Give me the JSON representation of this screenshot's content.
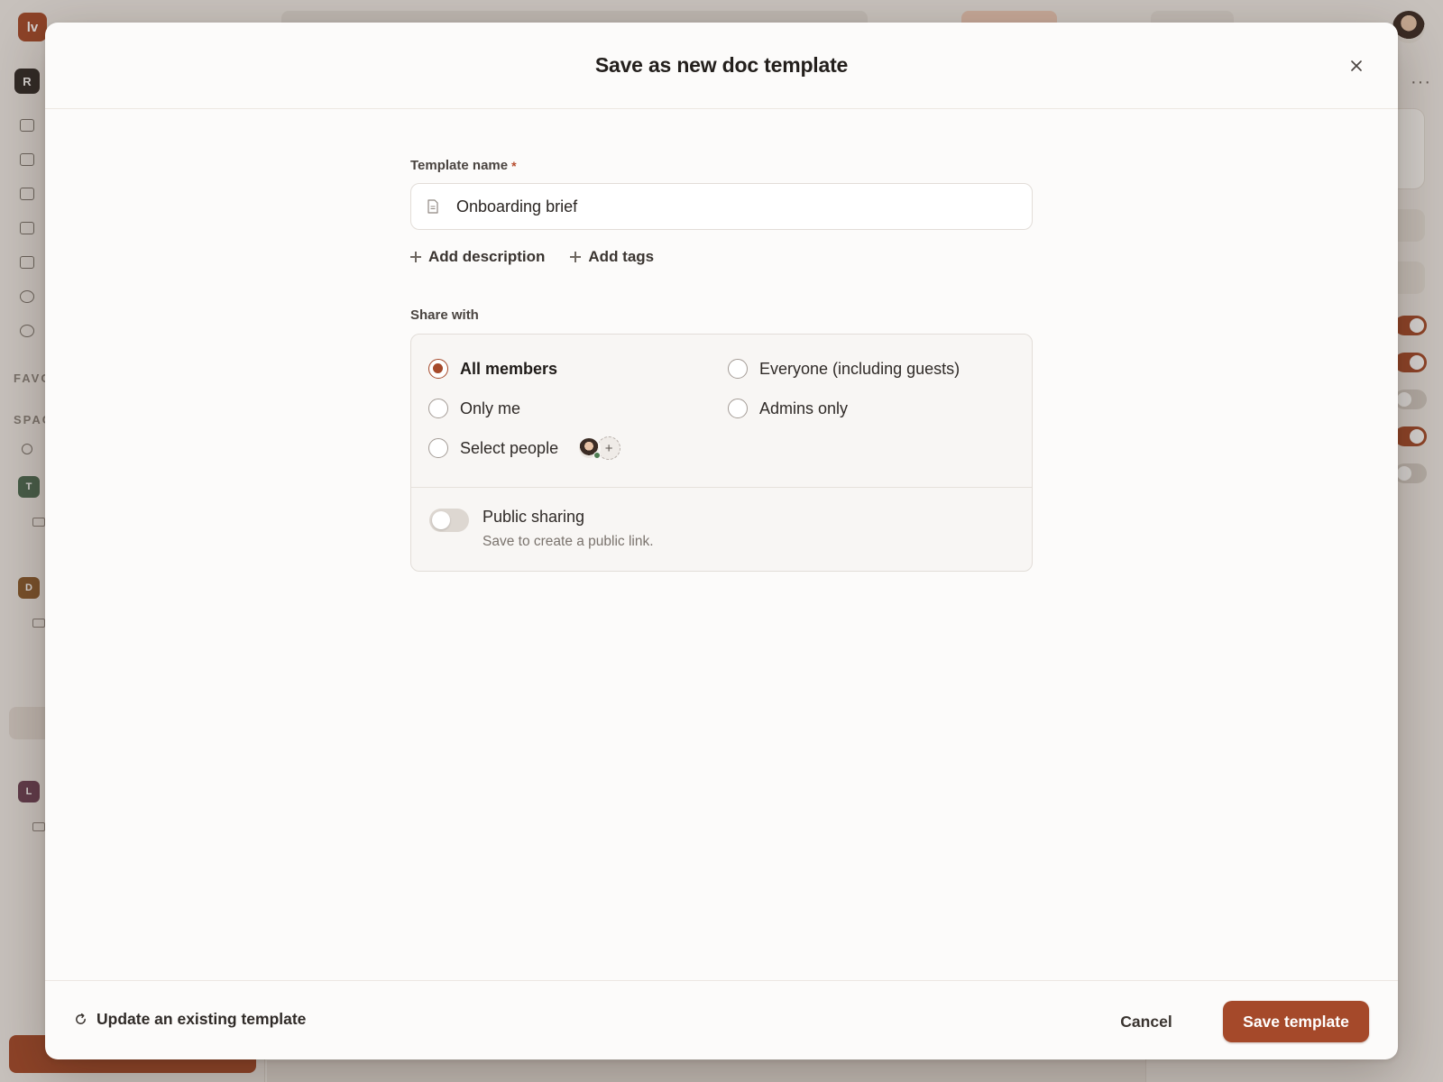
{
  "background": {
    "logo_text": "lv",
    "workspace_initial": "R",
    "favorites_label": "FAVO",
    "spaces_label": "SPAC",
    "space_initials": [
      "T",
      "D",
      "L"
    ]
  },
  "modal": {
    "title": "Save as new doc template",
    "close_icon": "close-icon"
  },
  "form": {
    "template_name_label": "Template name",
    "required_marker": "*",
    "template_name_value": "Onboarding brief",
    "add_description_label": "Add description",
    "add_tags_label": "Add tags",
    "share_with_label": "Share with",
    "share_options": [
      {
        "label": "All members",
        "selected": true
      },
      {
        "label": "Everyone (including guests)",
        "selected": false
      },
      {
        "label": "Only me",
        "selected": false
      },
      {
        "label": "Admins only",
        "selected": false
      },
      {
        "label": "Select people",
        "selected": false
      }
    ],
    "add_person_glyph": "+",
    "public_sharing": {
      "label": "Public sharing",
      "description": "Save to create a public link.",
      "enabled": false
    }
  },
  "footer": {
    "update_existing_label": "Update an existing template",
    "cancel_label": "Cancel",
    "save_label": "Save template"
  },
  "colors": {
    "accent": "#a5492a",
    "modal_bg": "#fcfbfa",
    "share_box_bg": "#f8f6f4"
  }
}
